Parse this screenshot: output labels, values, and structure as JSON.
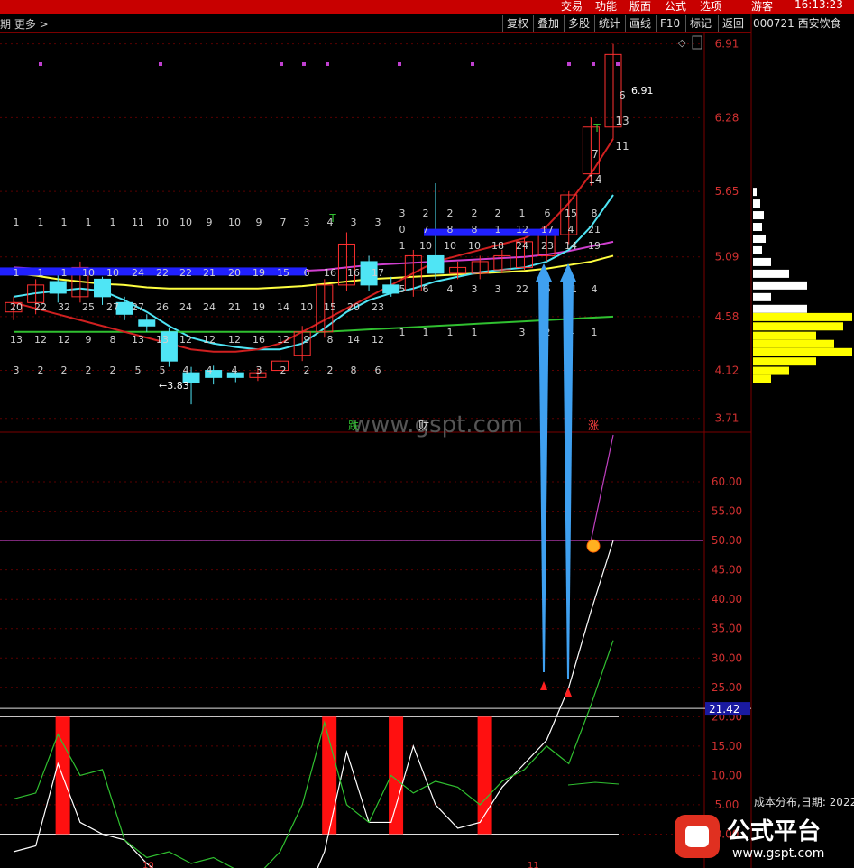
{
  "topbar": {
    "items": [
      "交易",
      "功能",
      "版面",
      "公式",
      "选项",
      "游客",
      "16:13:23"
    ]
  },
  "toolbar": {
    "left_text": "期  更多 >",
    "buttons": [
      "复权",
      "叠加",
      "多股",
      "统计",
      "画线",
      "F10",
      "标记",
      "返回"
    ]
  },
  "stock": {
    "code_name": "000721 西安饮食"
  },
  "price_panel": {
    "y_ticks": [
      "6.91",
      "6.28",
      "5.65",
      "5.09",
      "4.58",
      "4.12",
      "3.71"
    ],
    "high_label": "6.91",
    "low_label": "3.83",
    "annotations": [
      "T",
      "T"
    ],
    "watermark": "www.gspt.com",
    "markers": [
      "跌",
      "财",
      "涨"
    ]
  },
  "indicator_panel": {
    "y_ticks": [
      "60.00",
      "55.00",
      "50.00",
      "45.00",
      "40.00",
      "35.00",
      "30.00",
      "25.00",
      "20.00",
      "15.00",
      "10.00",
      "5.00",
      "0.00"
    ],
    "current_value": "21.42"
  },
  "cost_distribution": {
    "label": "成本分布,日期: 2022"
  },
  "logo": {
    "text": "公式平台",
    "url": "www.gspt.com"
  },
  "bottom": {
    "labels": [
      "10",
      "11"
    ]
  },
  "colors": {
    "red": "#ff0000",
    "cyan": "#4fe5f5",
    "blue": "#2020ff",
    "magenta": "#d040d0",
    "yellow": "#ffff40",
    "green": "#30c030",
    "white": "#ffffff",
    "panel_line": "#7a0000"
  },
  "chart_data": [
    {
      "type": "candlestick",
      "title": "000721 西安饮食",
      "ylim": [
        3.6,
        7.0
      ],
      "y_ticks": [
        6.91,
        6.28,
        5.65,
        5.09,
        4.58,
        4.12,
        3.71
      ],
      "candles": [
        {
          "o": 4.62,
          "c": 4.7,
          "h": 4.75,
          "l": 4.55
        },
        {
          "o": 4.7,
          "c": 4.85,
          "h": 4.9,
          "l": 4.6
        },
        {
          "o": 4.88,
          "c": 4.78,
          "h": 4.95,
          "l": 4.7
        },
        {
          "o": 4.75,
          "c": 5.0,
          "h": 5.05,
          "l": 4.7
        },
        {
          "o": 4.9,
          "c": 4.75,
          "h": 4.92,
          "l": 4.68
        },
        {
          "o": 4.7,
          "c": 4.6,
          "h": 4.75,
          "l": 4.55
        },
        {
          "o": 4.55,
          "c": 4.5,
          "h": 4.6,
          "l": 4.45
        },
        {
          "o": 4.45,
          "c": 4.2,
          "h": 4.48,
          "l": 4.15
        },
        {
          "o": 4.1,
          "c": 4.02,
          "h": 4.15,
          "l": 3.83
        },
        {
          "o": 4.12,
          "c": 4.06,
          "h": 4.16,
          "l": 4.0
        },
        {
          "o": 4.1,
          "c": 4.06,
          "h": 4.12,
          "l": 4.02
        },
        {
          "o": 4.06,
          "c": 4.1,
          "h": 4.14,
          "l": 4.03
        },
        {
          "o": 4.12,
          "c": 4.2,
          "h": 4.25,
          "l": 4.08
        },
        {
          "o": 4.25,
          "c": 4.45,
          "h": 4.5,
          "l": 4.2
        },
        {
          "o": 4.45,
          "c": 4.85,
          "h": 4.9,
          "l": 4.4
        },
        {
          "o": 4.85,
          "c": 5.2,
          "h": 5.3,
          "l": 4.8
        },
        {
          "o": 5.05,
          "c": 4.85,
          "h": 5.1,
          "l": 4.8
        },
        {
          "o": 4.85,
          "c": 4.78,
          "h": 4.92,
          "l": 4.75
        },
        {
          "o": 4.8,
          "c": 5.1,
          "h": 5.15,
          "l": 4.75
        },
        {
          "o": 5.1,
          "c": 4.95,
          "h": 5.72,
          "l": 4.9
        },
        {
          "o": 4.95,
          "c": 5.0,
          "h": 5.05,
          "l": 4.9
        },
        {
          "o": 4.95,
          "c": 5.05,
          "h": 5.1,
          "l": 4.9
        },
        {
          "o": 4.98,
          "c": 5.1,
          "h": 5.15,
          "l": 4.95
        },
        {
          "o": 5.0,
          "c": 5.22,
          "h": 5.25,
          "l": 4.98
        },
        {
          "o": 5.1,
          "c": 5.28,
          "h": 5.35,
          "l": 5.05
        },
        {
          "o": 5.28,
          "c": 5.62,
          "h": 5.65,
          "l": 5.2
        },
        {
          "o": 5.8,
          "c": 6.2,
          "h": 6.28,
          "l": 5.7
        },
        {
          "o": 6.2,
          "c": 6.82,
          "h": 6.91,
          "l": 6.1
        }
      ],
      "series": [
        {
          "name": "",
          "color": "#ffff40",
          "values": [
            4.95,
            4.93,
            4.9,
            4.88,
            4.86,
            4.85,
            4.83,
            4.82,
            4.82,
            4.82,
            4.82,
            4.82,
            4.83,
            4.84,
            4.86,
            4.88,
            4.9,
            4.91,
            4.92,
            4.93,
            4.94,
            4.95,
            4.96,
            4.97,
            4.99,
            5.02,
            5.05,
            5.1
          ]
        },
        {
          "name": "",
          "color": "#d040d0",
          "values": [
            5.0,
            4.99,
            4.98,
            4.98,
            4.97,
            4.97,
            4.96,
            4.96,
            4.96,
            4.96,
            4.96,
            4.96,
            4.96,
            4.97,
            4.98,
            5.0,
            5.02,
            5.03,
            5.04,
            5.05,
            5.06,
            5.07,
            5.08,
            5.09,
            5.11,
            5.14,
            5.18,
            5.22
          ]
        },
        {
          "name": "",
          "color": "#4fe5f5",
          "values": [
            4.75,
            4.78,
            4.8,
            4.82,
            4.8,
            4.72,
            4.62,
            4.5,
            4.4,
            4.35,
            4.32,
            4.3,
            4.3,
            4.35,
            4.48,
            4.62,
            4.72,
            4.78,
            4.82,
            4.88,
            4.92,
            4.96,
            4.98,
            5.0,
            5.05,
            5.15,
            5.35,
            5.62
          ]
        },
        {
          "name": "",
          "color": "#30c030",
          "values": [
            4.45,
            4.45,
            4.45,
            4.45,
            4.45,
            4.45,
            4.45,
            4.45,
            4.45,
            4.45,
            4.45,
            4.45,
            4.45,
            4.45,
            4.45,
            4.46,
            4.47,
            4.48,
            4.49,
            4.5,
            4.51,
            4.52,
            4.53,
            4.54,
            4.55,
            4.56,
            4.57,
            4.58
          ]
        },
        {
          "name": "",
          "color": "#d02020",
          "values": [
            4.7,
            4.65,
            4.6,
            4.55,
            4.5,
            4.45,
            4.4,
            4.35,
            4.3,
            4.28,
            4.28,
            4.3,
            4.35,
            4.45,
            4.55,
            4.65,
            4.75,
            4.85,
            4.95,
            5.05,
            5.1,
            5.15,
            5.2,
            5.25,
            5.35,
            5.55,
            5.8,
            6.1
          ]
        }
      ]
    },
    {
      "type": "line",
      "ylim": [
        -5,
        68
      ],
      "y_ticks": [
        60,
        55,
        50,
        45,
        40,
        35,
        30,
        25,
        20,
        15,
        10,
        5,
        0
      ],
      "threshold_lines": [
        50,
        21.42,
        20,
        0
      ],
      "current_value": 21.42,
      "signal_bars_x_index": [
        1,
        13,
        16,
        20
      ],
      "series": [
        {
          "name": "",
          "color": "#ffffff",
          "values": [
            -3,
            -2,
            12,
            2,
            0,
            -1,
            -5,
            -8,
            -10,
            -9,
            -11,
            -13,
            -13,
            -12,
            -3,
            14,
            2,
            2,
            15,
            5,
            1,
            2,
            8,
            12,
            16,
            25,
            38,
            50
          ]
        },
        {
          "name": "",
          "color": "#30c030",
          "values": [
            6,
            7,
            17,
            10,
            11,
            -1,
            -4,
            -3,
            -5,
            -4,
            -6,
            -7,
            -3,
            5,
            19,
            5,
            2,
            10,
            7,
            9,
            8,
            5,
            9,
            11,
            15,
            12,
            22,
            33
          ]
        },
        {
          "name": "",
          "color": "#c040c0",
          "values": [
            null,
            null,
            null,
            null,
            null,
            null,
            null,
            null,
            null,
            null,
            null,
            null,
            null,
            null,
            null,
            null,
            null,
            null,
            null,
            null,
            null,
            null,
            null,
            null,
            null,
            null,
            50,
            68
          ]
        }
      ]
    }
  ]
}
